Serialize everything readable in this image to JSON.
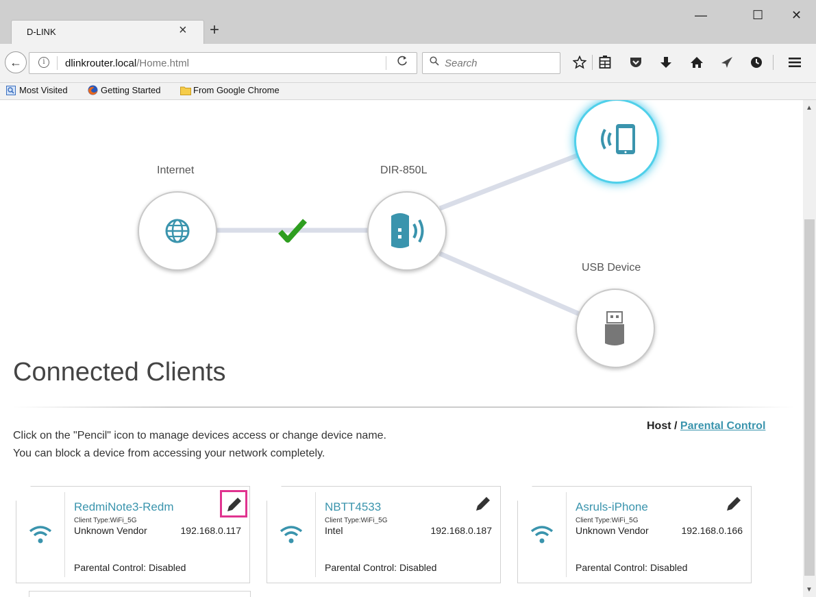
{
  "browser": {
    "tab_title": "D-LINK",
    "tab_close": "×",
    "new_tab": "+",
    "window": {
      "minimize": "—",
      "maximize": "☐",
      "close": "✕"
    },
    "url_host": "dlinkrouter.local",
    "url_path": "/Home.html",
    "search_placeholder": "Search",
    "bookmarks": [
      {
        "label": "Most Visited",
        "icon": "most-visited-icon"
      },
      {
        "label": "Getting Started",
        "icon": "firefox-icon"
      },
      {
        "label": "From Google Chrome",
        "icon": "folder-icon"
      }
    ],
    "toolbar_icons": [
      "bookmark-star-icon",
      "reading-list-icon",
      "pocket-icon",
      "downloads-icon",
      "home-icon",
      "send-tab-icon",
      "history-icon",
      "menu-icon"
    ]
  },
  "topology": {
    "internet_label": "Internet",
    "router_label": "DIR-850L",
    "usb_label": "USB Device",
    "status_icon": "check-icon",
    "colors": {
      "accent": "#3a94ad",
      "check": "#2e9e1f",
      "glow": "#4fd0ea"
    }
  },
  "clients": {
    "title": "Connected Clients",
    "intro_line1": "Click on the \"Pencil\" icon to manage devices access or change device name.",
    "intro_line2": "You can block a device from accessing your network completely.",
    "breadcrumb_host": "Host",
    "breadcrumb_sep": "/",
    "breadcrumb_parental": "Parental Control",
    "parental_label": "Parental Control:",
    "items": [
      {
        "name": "RedmiNote3-Redm",
        "type": "Client Type:WiFi_5G",
        "vendor": "Unknown Vendor",
        "ip": "192.168.0.117",
        "parental": "Disabled",
        "highlighted": true
      },
      {
        "name": "NBTT4533",
        "type": "Client Type:WiFi_5G",
        "vendor": "Intel",
        "ip": "192.168.0.187",
        "parental": "Disabled",
        "highlighted": false
      },
      {
        "name": "Asruls-iPhone",
        "type": "Client Type:WiFi_5G",
        "vendor": "Unknown Vendor",
        "ip": "192.168.0.166",
        "parental": "Disabled",
        "highlighted": false
      }
    ]
  }
}
